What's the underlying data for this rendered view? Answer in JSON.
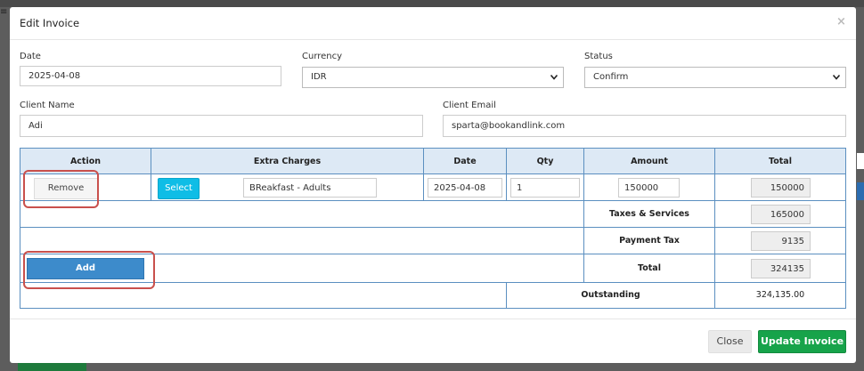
{
  "modal": {
    "title": "Edit Invoice",
    "close_glyph": "×"
  },
  "form": {
    "date_label": "Date",
    "date_value": "2025-04-08",
    "currency_label": "Currency",
    "currency_value": "IDR",
    "status_label": "Status",
    "status_value": "Confirm",
    "client_name_label": "Client Name",
    "client_name_value": "Adi",
    "client_email_label": "Client Email",
    "client_email_value": "sparta@bookandlink.com"
  },
  "table": {
    "headers": [
      "Action",
      "Extra Charges",
      "Date",
      "Qty",
      "Amount",
      "Total"
    ],
    "row": {
      "remove_label": "Remove",
      "select_label": "Select",
      "charge_name": "BReakfast - Adults",
      "date": "2025-04-08",
      "qty": "1",
      "amount": "150000",
      "total": "150000"
    },
    "taxes_label": "Taxes & Services",
    "taxes_value": "165000",
    "payment_tax_label": "Payment Tax",
    "payment_tax_value": "9135",
    "total_label": "Total",
    "total_value": "324135",
    "add_label": "Add",
    "outstanding_label": "Outstanding",
    "outstanding_value": "324,135.00"
  },
  "footer": {
    "close_label": "Close",
    "update_label": "Update Invoice"
  },
  "colors": {
    "highlight": "#c9504c",
    "select_button": "#0fbde6",
    "add_button": "#3d8bcb",
    "update_button": "#17a34a",
    "table_header_bg": "#dde9f5",
    "table_border": "#5b8fc0"
  },
  "backdrop": {
    "hamburger_glyph": "≡"
  }
}
